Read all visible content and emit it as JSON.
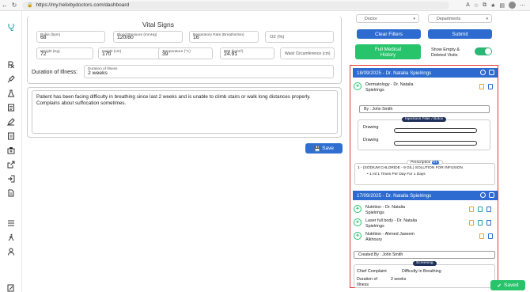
{
  "browser": {
    "url": "https://my.helixbydoctors.com/dashboard"
  },
  "vitals": {
    "title": "Vital Signs",
    "pulse": {
      "label": "Pulse (bpm)",
      "value": "68"
    },
    "bp": {
      "label": "Blood Pressure (mmHg)",
      "value": "120/80"
    },
    "resp": {
      "label": "Respiratory Rate (Breaths/min)",
      "value": "16"
    },
    "o2": {
      "placeholder": "O2 (%)"
    },
    "weight": {
      "label": "Weight (Kg)",
      "value": "72"
    },
    "height": {
      "label": "Height (cm)",
      "value": "170"
    },
    "temp": {
      "label": "Temperature (°C)",
      "value": "39"
    },
    "bmi": {
      "label": "BMI (kg/m²)",
      "value": "24.91"
    },
    "waist": {
      "placeholder": "Waist Circumference (cm)"
    }
  },
  "illness": {
    "label": "Duration of Illness:",
    "field_label": "Duration of Illness",
    "value": "2 weeks"
  },
  "complaint": {
    "text": "Patient has been facing difficulty in breathing since last 2 weeks and is unable to climb stairs or walk long distances properly. Complains about suffocation sometimes."
  },
  "save_label": "Save",
  "filters": {
    "doctor_placeholder": "Doctor",
    "departments_placeholder": "Departments",
    "clear_label": "Clear Filters",
    "submit_label": "Submit",
    "full_history_line1": "Full Medical",
    "full_history_line2": "History",
    "toggle_line1": "Show Empty &",
    "toggle_line2": "Deleted Visits"
  },
  "visits": [
    {
      "header": "18/09/2025 - Dr. Natalia Spielrings",
      "entries": [
        {
          "line1": "Dermatology - Dr. Natalia",
          "line2": "Spielrings"
        }
      ],
      "by": "By : John Smith",
      "section_label": "Injections Filler / Botox",
      "drawing_label_1": "Drawing",
      "drawing_label_2": "Drawing",
      "prescription_label": "Prescription",
      "prescription_count": "01",
      "rx_line": "1 - (SODIUM CHLORIDE - 9 G/L) SOLUTION FOR INFUSION",
      "rx_detail": "1 ml 1 Times Per Day For 1 Days"
    },
    {
      "header": "17/09/2025 - Dr. Natalia Spielrings",
      "entries": [
        {
          "line1": "Nutrition - Dr. Natalia",
          "line2": "Spielrings"
        },
        {
          "line1": "Laser full body - Dr. Natalia",
          "line2": "Spielrings"
        },
        {
          "line1": "Nutrition - Ahmed Jaseem",
          "line2": "Alkhoury"
        }
      ],
      "created_by": "Created By : John Smith",
      "screening_label": "Screening",
      "chief_label": "Chief Complaint",
      "chief_value": "Difficulty in Breathing",
      "duration_label_1": "Duration of",
      "duration_label_2": "Illness",
      "duration_value": "2 weeks"
    }
  ],
  "toast": {
    "label": "Saved"
  },
  "colors": {
    "primary": "#2d6bd0",
    "success": "#27c46b",
    "highlight": "#e53935"
  }
}
